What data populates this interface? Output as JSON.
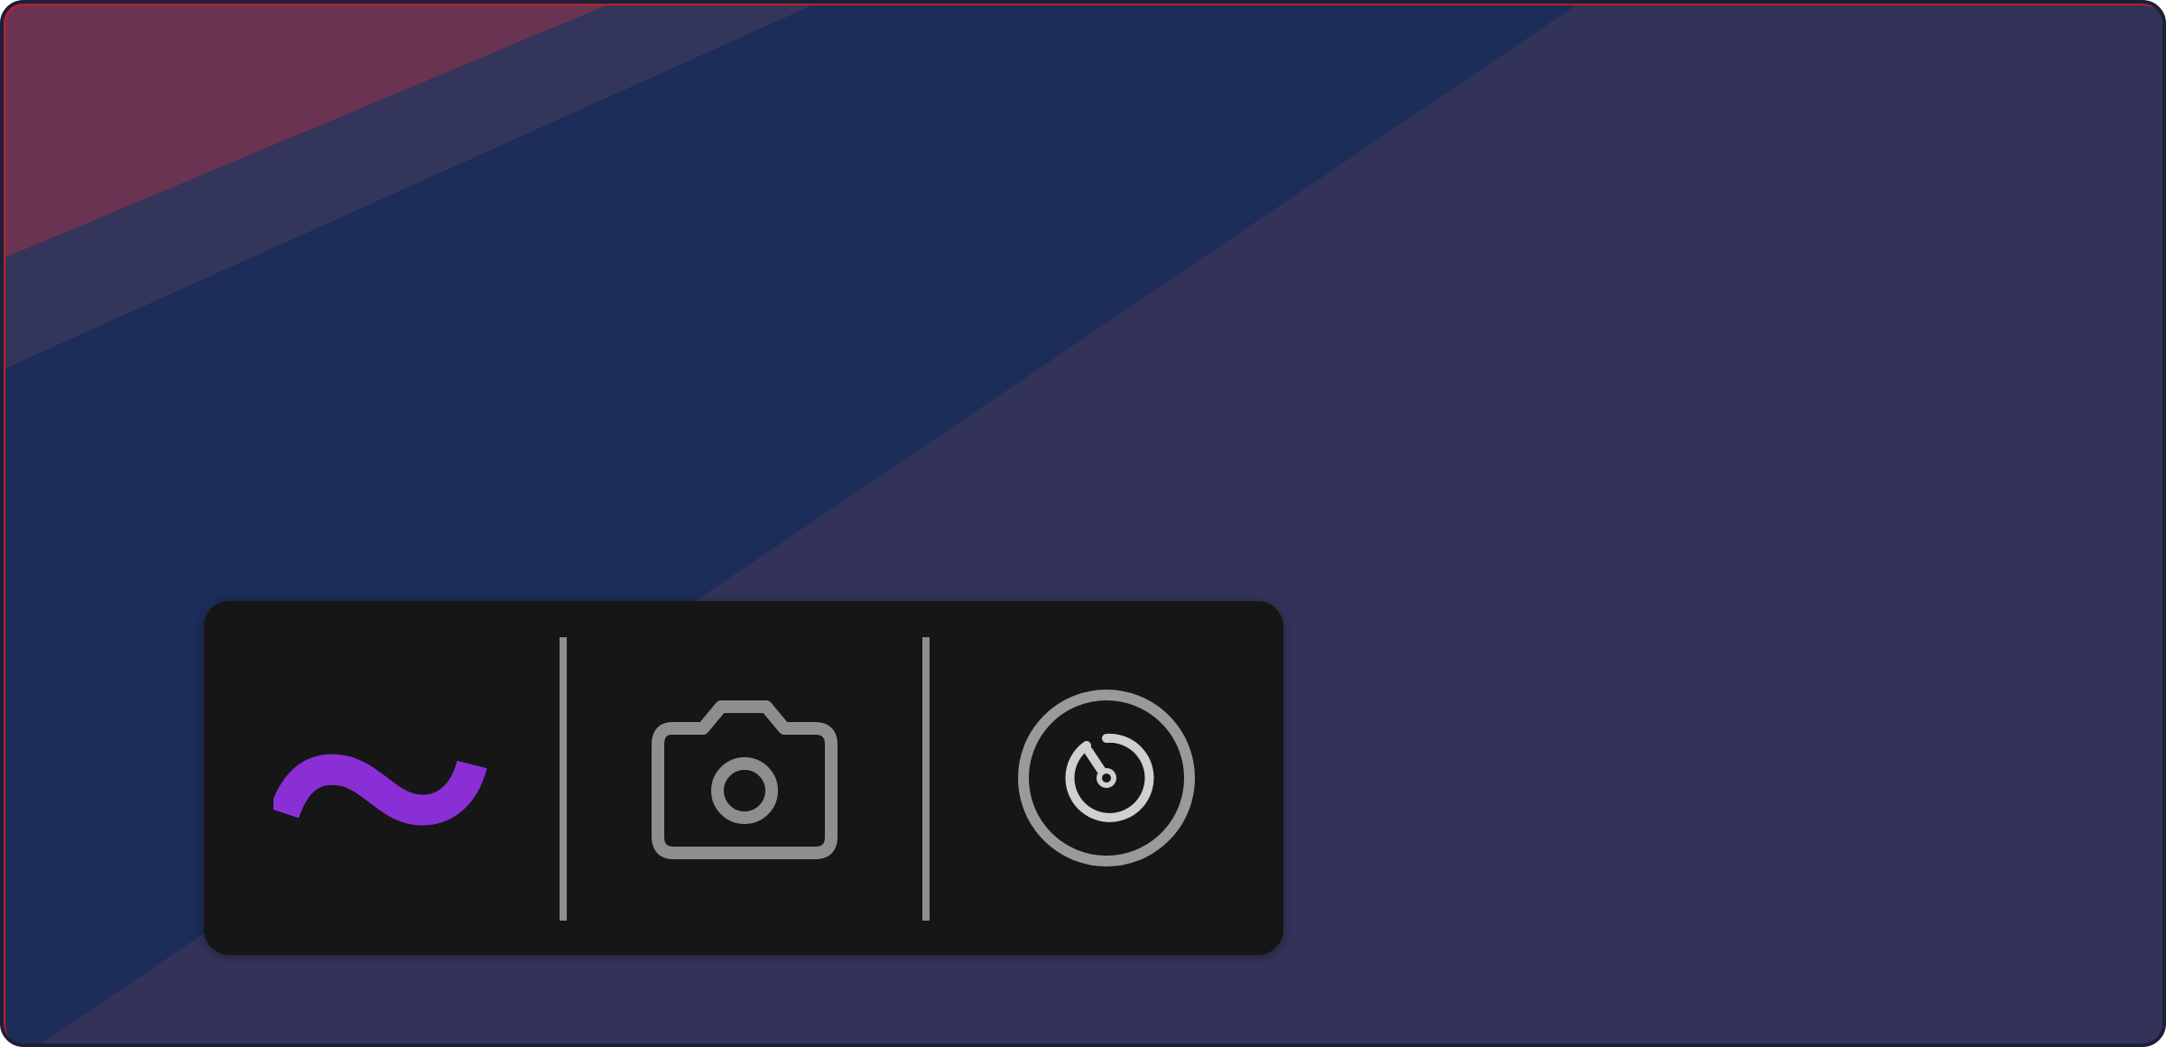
{
  "window": {
    "frame_color": "#1c2036",
    "accent_edge_color": "#b8202e"
  },
  "wallpaper": {
    "colors": [
      "#6b3352",
      "#34355a",
      "#1b2d58",
      "#33335a"
    ]
  },
  "toolbar": {
    "background_color": "#161616",
    "divider_color": "#8e8e8e",
    "buttons": [
      {
        "name": "draw",
        "icon": "squiggle-icon",
        "color": "#8a2fd6",
        "active": true
      },
      {
        "name": "screenshot",
        "icon": "camera-icon",
        "color": "#8e8e8e",
        "active": false
      },
      {
        "name": "timer",
        "icon": "timer-dial-icon",
        "color": "#9a9a9a",
        "active": false
      }
    ]
  }
}
